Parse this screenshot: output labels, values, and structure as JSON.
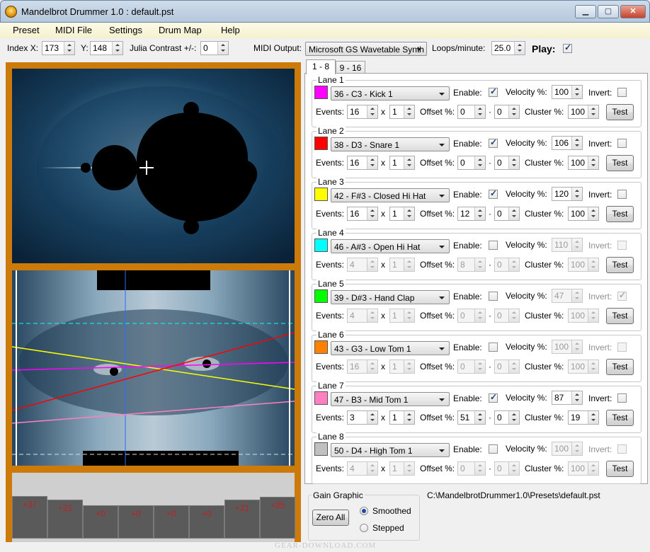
{
  "window": {
    "title": "Mandelbrot Drummer 1.0 : default.pst",
    "min": "▁",
    "max": "▢",
    "close": "✕"
  },
  "menu": [
    "Preset",
    "MIDI File",
    "Settings",
    "Drum Map",
    "Help"
  ],
  "toolbar": {
    "index_x_label": "Index X:",
    "index_x": "173",
    "y_label": "Y:",
    "y": "148",
    "julia_label": "Julia Contrast +/-:",
    "julia": "0",
    "midi_output_label": "MIDI Output:",
    "midi_output": "Microsoft GS Wavetable Synth",
    "loops_label": "Loops/minute:",
    "loops": "25.0",
    "play_label": "Play:",
    "play_checked": true
  },
  "tabs": [
    "1 - 8",
    "9 - 16"
  ],
  "lane_labels": {
    "enable": "Enable:",
    "velocity": "Velocity %:",
    "invert": "Invert:",
    "events": "Events:",
    "x": "x",
    "offset": "Offset %:",
    "dot": "·",
    "cluster": "Cluster %:",
    "test": "Test"
  },
  "lanes": [
    {
      "title": "Lane 1",
      "color": "#ff00ff",
      "drum": "36 - C3 - Kick 1",
      "enabled": true,
      "velocity": "100",
      "invert": false,
      "events": "16",
      "mult": "1",
      "offset": "0",
      "offset2": "0",
      "cluster": "100"
    },
    {
      "title": "Lane 2",
      "color": "#ff0000",
      "drum": "38 - D3 - Snare 1",
      "enabled": true,
      "velocity": "106",
      "invert": false,
      "events": "16",
      "mult": "1",
      "offset": "0",
      "offset2": "0",
      "cluster": "100"
    },
    {
      "title": "Lane 3",
      "color": "#ffff00",
      "drum": "42 - F#3 - Closed Hi Hat",
      "enabled": true,
      "velocity": "120",
      "invert": false,
      "events": "16",
      "mult": "1",
      "offset": "12",
      "offset2": "0",
      "cluster": "100"
    },
    {
      "title": "Lane 4",
      "color": "#00ffff",
      "drum": "46 - A#3 - Open Hi Hat",
      "enabled": false,
      "velocity": "110",
      "invert": false,
      "events": "4",
      "mult": "1",
      "offset": "8",
      "offset2": "0",
      "cluster": "100"
    },
    {
      "title": "Lane 5",
      "color": "#00ff00",
      "drum": "39 - D#3 - Hand Clap",
      "enabled": false,
      "velocity": "47",
      "invert": true,
      "events": "4",
      "mult": "1",
      "offset": "0",
      "offset2": "0",
      "cluster": "100"
    },
    {
      "title": "Lane 6",
      "color": "#ff8000",
      "drum": "43 - G3 - Low Tom 1",
      "enabled": false,
      "velocity": "100",
      "invert": false,
      "events": "16",
      "mult": "1",
      "offset": "0",
      "offset2": "0",
      "cluster": "100"
    },
    {
      "title": "Lane 7",
      "color": "#ff80c0",
      "drum": "47 - B3 - Mid Tom 1",
      "enabled": true,
      "velocity": "87",
      "invert": false,
      "events": "3",
      "mult": "1",
      "offset": "51",
      "offset2": "0",
      "cluster": "19"
    },
    {
      "title": "Lane 8",
      "color": "#c0c0c0",
      "drum": "50 - D4 - High Tom 1",
      "enabled": false,
      "velocity": "100",
      "invert": false,
      "events": "4",
      "mult": "1",
      "offset": "0",
      "offset2": "0",
      "cluster": "100"
    }
  ],
  "gain": {
    "title": "Gain Graphic",
    "zero_all": "Zero All",
    "smoothed": "Smoothed",
    "stepped": "Stepped",
    "selected": "smoothed"
  },
  "pads": [
    {
      "label": "+37",
      "level": 37
    },
    {
      "label": "+21",
      "level": 21
    },
    {
      "label": "+0",
      "level": 0
    },
    {
      "label": "+0",
      "level": 0
    },
    {
      "label": "+0",
      "level": 0
    },
    {
      "label": "+0",
      "level": 0
    },
    {
      "label": "+21",
      "level": 21
    },
    {
      "label": "+35",
      "level": 35
    }
  ],
  "preset_path": "C:\\MandelbrotDrummer1.0\\Presets\\default.pst",
  "watermark": "GEAR-DOWNLOAD.COM"
}
